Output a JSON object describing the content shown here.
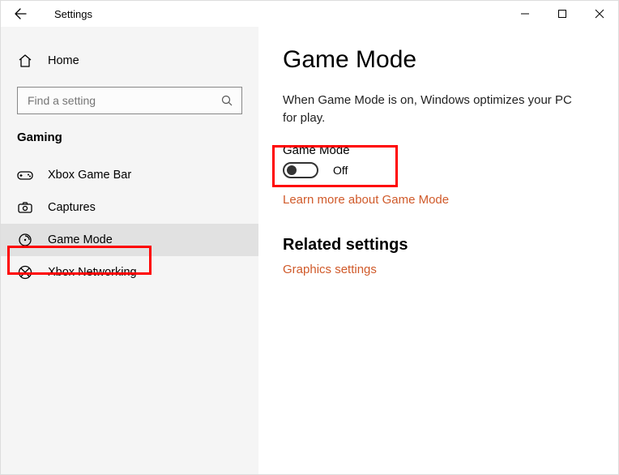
{
  "titlebar": {
    "title": "Settings"
  },
  "sidebar": {
    "home_label": "Home",
    "search_placeholder": "Find a setting",
    "section_label": "Gaming",
    "items": [
      {
        "label": "Xbox Game Bar"
      },
      {
        "label": "Captures"
      },
      {
        "label": "Game Mode"
      },
      {
        "label": "Xbox Networking"
      }
    ]
  },
  "main": {
    "title": "Game Mode",
    "description": "When Game Mode is on, Windows optimizes your PC for play.",
    "toggle": {
      "label": "Game Mode",
      "state_text": "Off"
    },
    "learn_more_link": "Learn more about Game Mode",
    "related_heading": "Related settings",
    "graphics_link": "Graphics settings"
  }
}
